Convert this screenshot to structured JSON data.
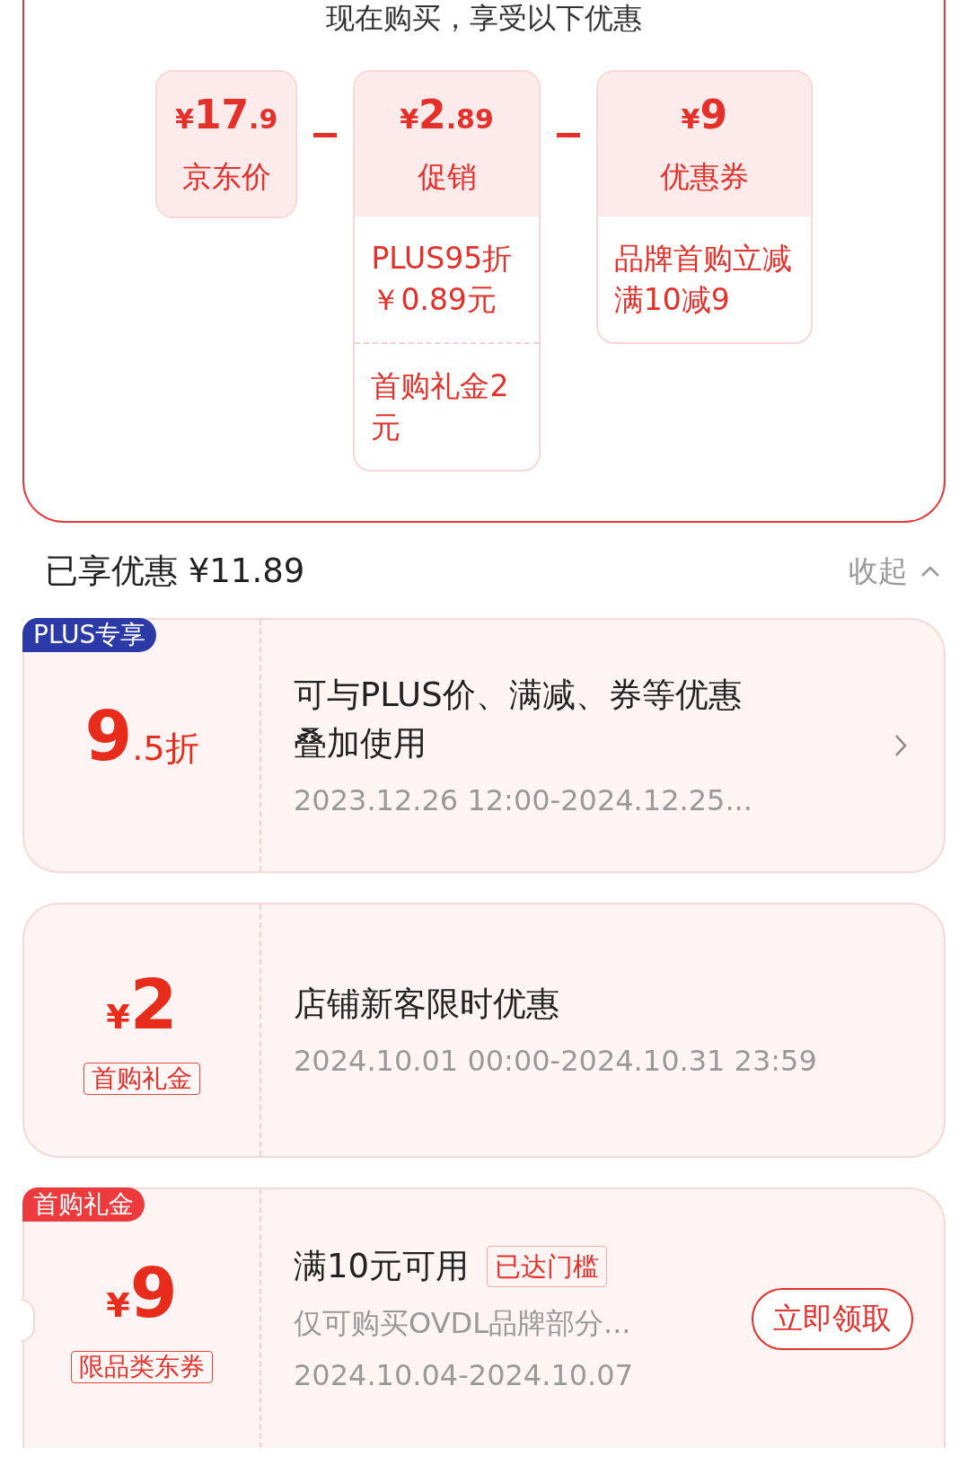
{
  "offer_panel": {
    "title": "现在购买，享受以下优惠",
    "prices": [
      {
        "currency": "¥",
        "integer": "17",
        "decimal": ".9",
        "label": "京东价"
      },
      {
        "currency": "¥",
        "integer": "2",
        "decimal": ".89",
        "label": "促销",
        "details": [
          "PLUS95折￥0.89元",
          "首购礼金2元"
        ]
      },
      {
        "currency": "¥",
        "integer": "9",
        "label": "优惠券",
        "details": [
          "品牌首购立减满10减9"
        ]
      }
    ]
  },
  "summary": {
    "label": "已享优惠 ¥11.89",
    "collapse": "收起"
  },
  "cards": [
    {
      "tag": {
        "text": "PLUS专享",
        "kind": "plus"
      },
      "amount": {
        "main": "9",
        "suffix": ".5折"
      },
      "title": "可与PLUS价、满减、券等优惠叠加使用",
      "dates": "2023.12.26 12:00-2024.12.25...",
      "action": {
        "kind": "chevron"
      }
    },
    {
      "amount": {
        "prefix": "¥",
        "main": "2"
      },
      "label": "首购礼金",
      "title": "店铺新客限时优惠",
      "dates": "2024.10.01 00:00-2024.10.31 23:59"
    },
    {
      "tag": {
        "text": "首购礼金",
        "kind": "gift"
      },
      "amount": {
        "prefix": "¥",
        "main": "9"
      },
      "label": "限品类东券",
      "title": "满10元可用",
      "badge": "已达门槛",
      "description": "仅可购买OVDL品牌部分...",
      "dates": "2024.10.04-2024.10.07",
      "action": {
        "kind": "button",
        "label": "立即领取"
      }
    }
  ]
}
